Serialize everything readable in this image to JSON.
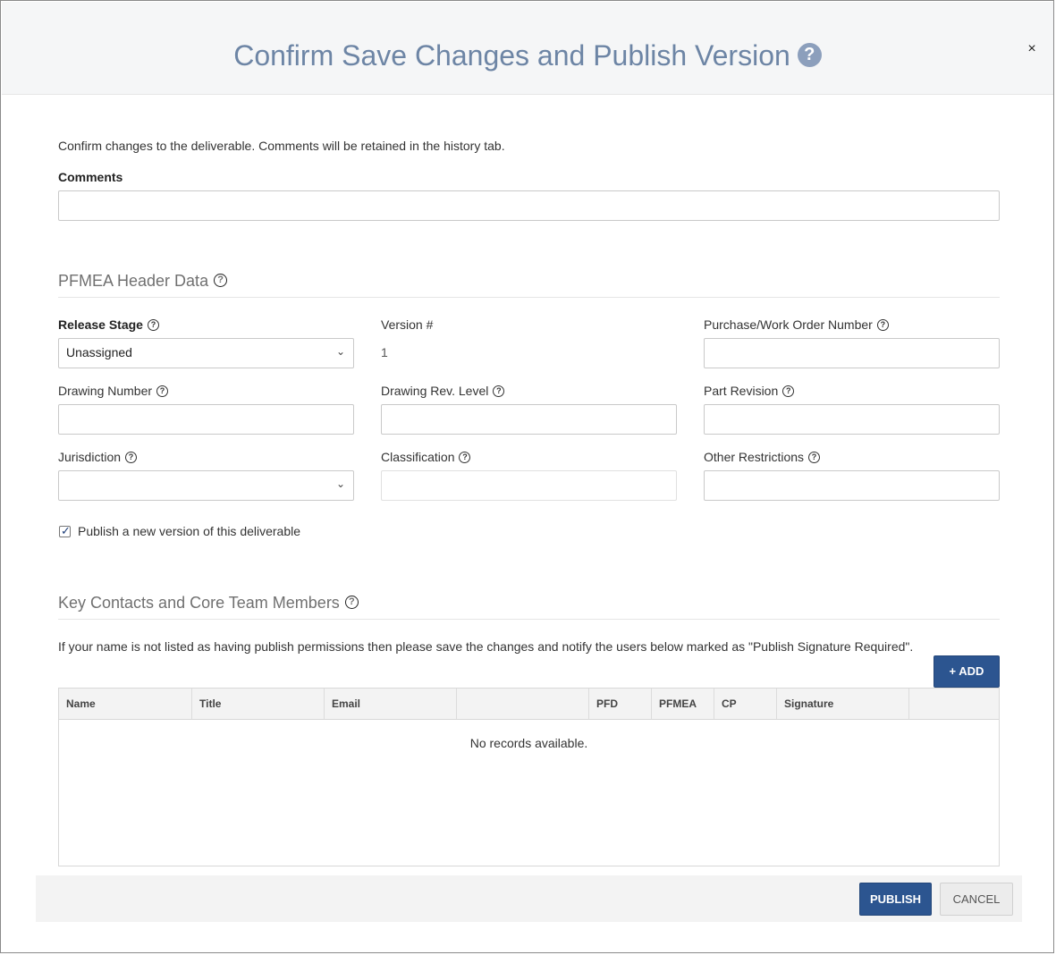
{
  "modal": {
    "title": "Confirm Save Changes and Publish Version",
    "help_glyph": "?",
    "close_glyph": "×"
  },
  "intro_text": "Confirm changes to the deliverable. Comments will be retained in the history tab.",
  "comments": {
    "label": "Comments",
    "value": "",
    "placeholder": ""
  },
  "header_data": {
    "title": "PFMEA Header Data",
    "release_stage": {
      "label": "Release Stage",
      "value": "Unassigned"
    },
    "version": {
      "label": "Version #",
      "value": "1"
    },
    "purchase_order": {
      "label": "Purchase/Work Order Number",
      "value": ""
    },
    "drawing_number": {
      "label": "Drawing Number",
      "value": ""
    },
    "drawing_rev": {
      "label": "Drawing Rev. Level",
      "value": ""
    },
    "part_revision": {
      "label": "Part Revision",
      "value": ""
    },
    "jurisdiction": {
      "label": "Jurisdiction",
      "value": ""
    },
    "classification": {
      "label": "Classification",
      "value": ""
    },
    "other_restrictions": {
      "label": "Other Restrictions",
      "value": ""
    }
  },
  "publish_checkbox": {
    "label": "Publish a new version of this deliverable",
    "checked": true
  },
  "contacts": {
    "title": "Key Contacts and Core Team Members",
    "notice": "If your name is not listed as having publish permissions then please save the changes and notify the users below marked as \"Publish Signature Required\".",
    "add_label": "+ ADD",
    "columns": [
      "Name",
      "Title",
      "Email",
      "",
      "PFD",
      "PFMEA",
      "CP",
      "Signature",
      ""
    ],
    "rows": [],
    "empty_message": "No records available."
  },
  "footer": {
    "publish_label": "PUBLISH",
    "cancel_label": "CANCEL"
  },
  "colors": {
    "primary": "#2c5590",
    "title": "#6d85a5"
  },
  "icons": {
    "help": "help-circle-icon",
    "close": "close-icon",
    "chevron": "chevron-down-icon",
    "check": "checkmark-icon"
  }
}
